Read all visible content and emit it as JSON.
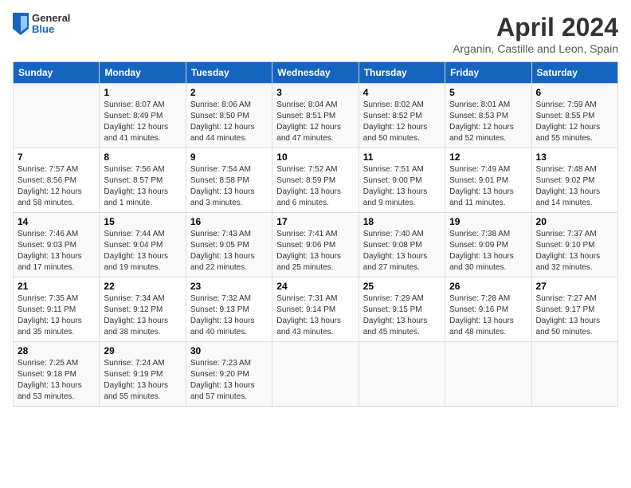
{
  "header": {
    "logo_general": "General",
    "logo_blue": "Blue",
    "title": "April 2024",
    "subtitle": "Arganin, Castille and Leon, Spain"
  },
  "calendar": {
    "columns": [
      "Sunday",
      "Monday",
      "Tuesday",
      "Wednesday",
      "Thursday",
      "Friday",
      "Saturday"
    ],
    "weeks": [
      [
        {
          "day": "",
          "info": ""
        },
        {
          "day": "1",
          "info": "Sunrise: 8:07 AM\nSunset: 8:49 PM\nDaylight: 12 hours\nand 41 minutes."
        },
        {
          "day": "2",
          "info": "Sunrise: 8:06 AM\nSunset: 8:50 PM\nDaylight: 12 hours\nand 44 minutes."
        },
        {
          "day": "3",
          "info": "Sunrise: 8:04 AM\nSunset: 8:51 PM\nDaylight: 12 hours\nand 47 minutes."
        },
        {
          "day": "4",
          "info": "Sunrise: 8:02 AM\nSunset: 8:52 PM\nDaylight: 12 hours\nand 50 minutes."
        },
        {
          "day": "5",
          "info": "Sunrise: 8:01 AM\nSunset: 8:53 PM\nDaylight: 12 hours\nand 52 minutes."
        },
        {
          "day": "6",
          "info": "Sunrise: 7:59 AM\nSunset: 8:55 PM\nDaylight: 12 hours\nand 55 minutes."
        }
      ],
      [
        {
          "day": "7",
          "info": "Sunrise: 7:57 AM\nSunset: 8:56 PM\nDaylight: 12 hours\nand 58 minutes."
        },
        {
          "day": "8",
          "info": "Sunrise: 7:56 AM\nSunset: 8:57 PM\nDaylight: 13 hours\nand 1 minute."
        },
        {
          "day": "9",
          "info": "Sunrise: 7:54 AM\nSunset: 8:58 PM\nDaylight: 13 hours\nand 3 minutes."
        },
        {
          "day": "10",
          "info": "Sunrise: 7:52 AM\nSunset: 8:59 PM\nDaylight: 13 hours\nand 6 minutes."
        },
        {
          "day": "11",
          "info": "Sunrise: 7:51 AM\nSunset: 9:00 PM\nDaylight: 13 hours\nand 9 minutes."
        },
        {
          "day": "12",
          "info": "Sunrise: 7:49 AM\nSunset: 9:01 PM\nDaylight: 13 hours\nand 11 minutes."
        },
        {
          "day": "13",
          "info": "Sunrise: 7:48 AM\nSunset: 9:02 PM\nDaylight: 13 hours\nand 14 minutes."
        }
      ],
      [
        {
          "day": "14",
          "info": "Sunrise: 7:46 AM\nSunset: 9:03 PM\nDaylight: 13 hours\nand 17 minutes."
        },
        {
          "day": "15",
          "info": "Sunrise: 7:44 AM\nSunset: 9:04 PM\nDaylight: 13 hours\nand 19 minutes."
        },
        {
          "day": "16",
          "info": "Sunrise: 7:43 AM\nSunset: 9:05 PM\nDaylight: 13 hours\nand 22 minutes."
        },
        {
          "day": "17",
          "info": "Sunrise: 7:41 AM\nSunset: 9:06 PM\nDaylight: 13 hours\nand 25 minutes."
        },
        {
          "day": "18",
          "info": "Sunrise: 7:40 AM\nSunset: 9:08 PM\nDaylight: 13 hours\nand 27 minutes."
        },
        {
          "day": "19",
          "info": "Sunrise: 7:38 AM\nSunset: 9:09 PM\nDaylight: 13 hours\nand 30 minutes."
        },
        {
          "day": "20",
          "info": "Sunrise: 7:37 AM\nSunset: 9:10 PM\nDaylight: 13 hours\nand 32 minutes."
        }
      ],
      [
        {
          "day": "21",
          "info": "Sunrise: 7:35 AM\nSunset: 9:11 PM\nDaylight: 13 hours\nand 35 minutes."
        },
        {
          "day": "22",
          "info": "Sunrise: 7:34 AM\nSunset: 9:12 PM\nDaylight: 13 hours\nand 38 minutes."
        },
        {
          "day": "23",
          "info": "Sunrise: 7:32 AM\nSunset: 9:13 PM\nDaylight: 13 hours\nand 40 minutes."
        },
        {
          "day": "24",
          "info": "Sunrise: 7:31 AM\nSunset: 9:14 PM\nDaylight: 13 hours\nand 43 minutes."
        },
        {
          "day": "25",
          "info": "Sunrise: 7:29 AM\nSunset: 9:15 PM\nDaylight: 13 hours\nand 45 minutes."
        },
        {
          "day": "26",
          "info": "Sunrise: 7:28 AM\nSunset: 9:16 PM\nDaylight: 13 hours\nand 48 minutes."
        },
        {
          "day": "27",
          "info": "Sunrise: 7:27 AM\nSunset: 9:17 PM\nDaylight: 13 hours\nand 50 minutes."
        }
      ],
      [
        {
          "day": "28",
          "info": "Sunrise: 7:25 AM\nSunset: 9:18 PM\nDaylight: 13 hours\nand 53 minutes."
        },
        {
          "day": "29",
          "info": "Sunrise: 7:24 AM\nSunset: 9:19 PM\nDaylight: 13 hours\nand 55 minutes."
        },
        {
          "day": "30",
          "info": "Sunrise: 7:23 AM\nSunset: 9:20 PM\nDaylight: 13 hours\nand 57 minutes."
        },
        {
          "day": "",
          "info": ""
        },
        {
          "day": "",
          "info": ""
        },
        {
          "day": "",
          "info": ""
        },
        {
          "day": "",
          "info": ""
        }
      ]
    ]
  }
}
